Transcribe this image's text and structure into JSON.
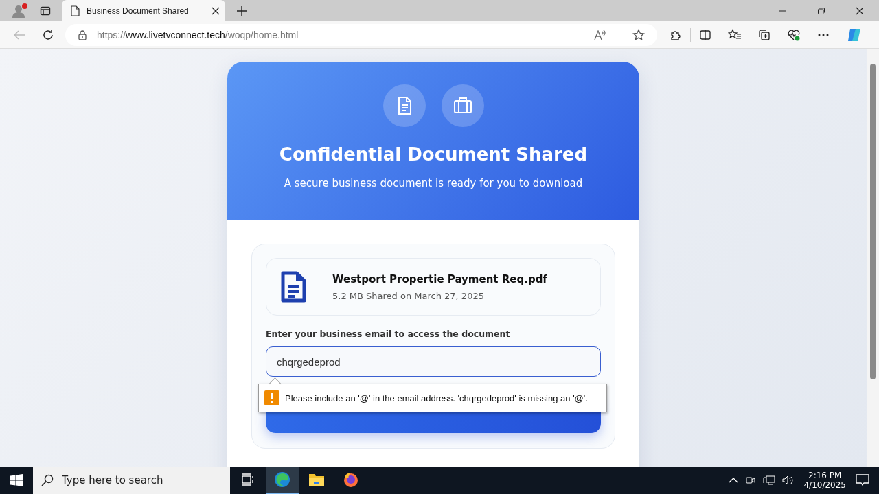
{
  "browser": {
    "tab": {
      "title": "Business Document Shared"
    },
    "address": {
      "scheme": "https://",
      "host": "www.livetvconnect.tech",
      "path": "/woqp/home.html"
    }
  },
  "header": {
    "title": "Confidential Document Shared",
    "subtitle": "A secure business document is ready for you to download"
  },
  "file": {
    "name": "Westport Propertie Payment Req.pdf",
    "meta": "5.2 MB Shared on March 27, 2025"
  },
  "email": {
    "label": "Enter your business email to access the document",
    "value": "chqrgedeprod"
  },
  "validation_tooltip": {
    "message": "Please include an '@' in the email address. 'chqrgedeprod' is missing an '@'."
  },
  "taskbar": {
    "search": {
      "placeholder": "Type here to search"
    },
    "apps": [
      {
        "kind": "taskview",
        "selected": false
      },
      {
        "kind": "edge",
        "selected": true
      },
      {
        "kind": "explorer",
        "selected": false
      },
      {
        "kind": "firefox",
        "selected": false
      }
    ],
    "clock": {
      "time": "2:16 PM",
      "date": "4/10/2025"
    }
  }
}
